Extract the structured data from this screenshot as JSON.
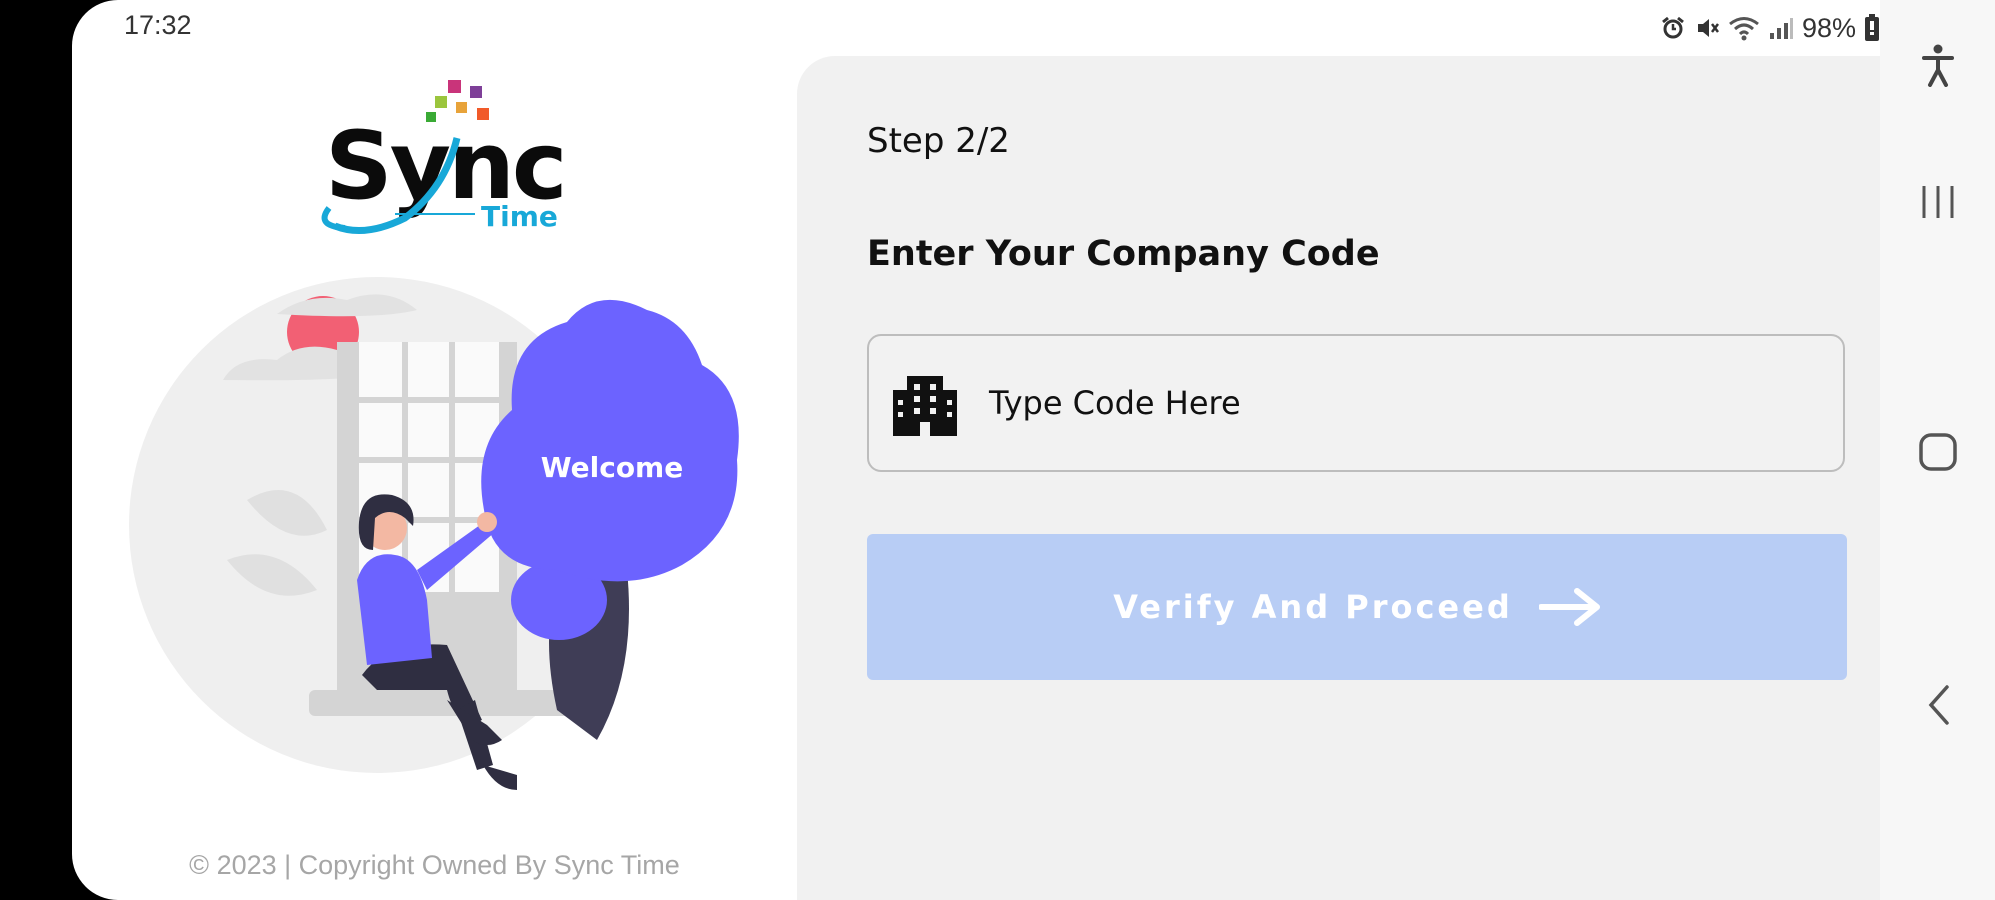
{
  "status_bar": {
    "time": "17:32",
    "battery": "98%"
  },
  "logo": {
    "word": "Sync",
    "sub": "Time"
  },
  "illustration": {
    "bubble_text": "Welcome"
  },
  "footer": {
    "copyright": "© 2023 | Copyright Owned By Sync Time"
  },
  "form": {
    "step": "Step 2/2",
    "heading": "Enter Your Company Code",
    "code_placeholder": "Type Code Here",
    "verify_label": "Verify And Proceed"
  },
  "nav_bar": {
    "icons": [
      "accessibility-icon",
      "recent-apps-icon",
      "home-icon",
      "back-icon"
    ]
  },
  "colors": {
    "accent": "#6c63ff",
    "button_disabled": "#b8cdf5",
    "logo_cyan": "#18a8d8"
  }
}
